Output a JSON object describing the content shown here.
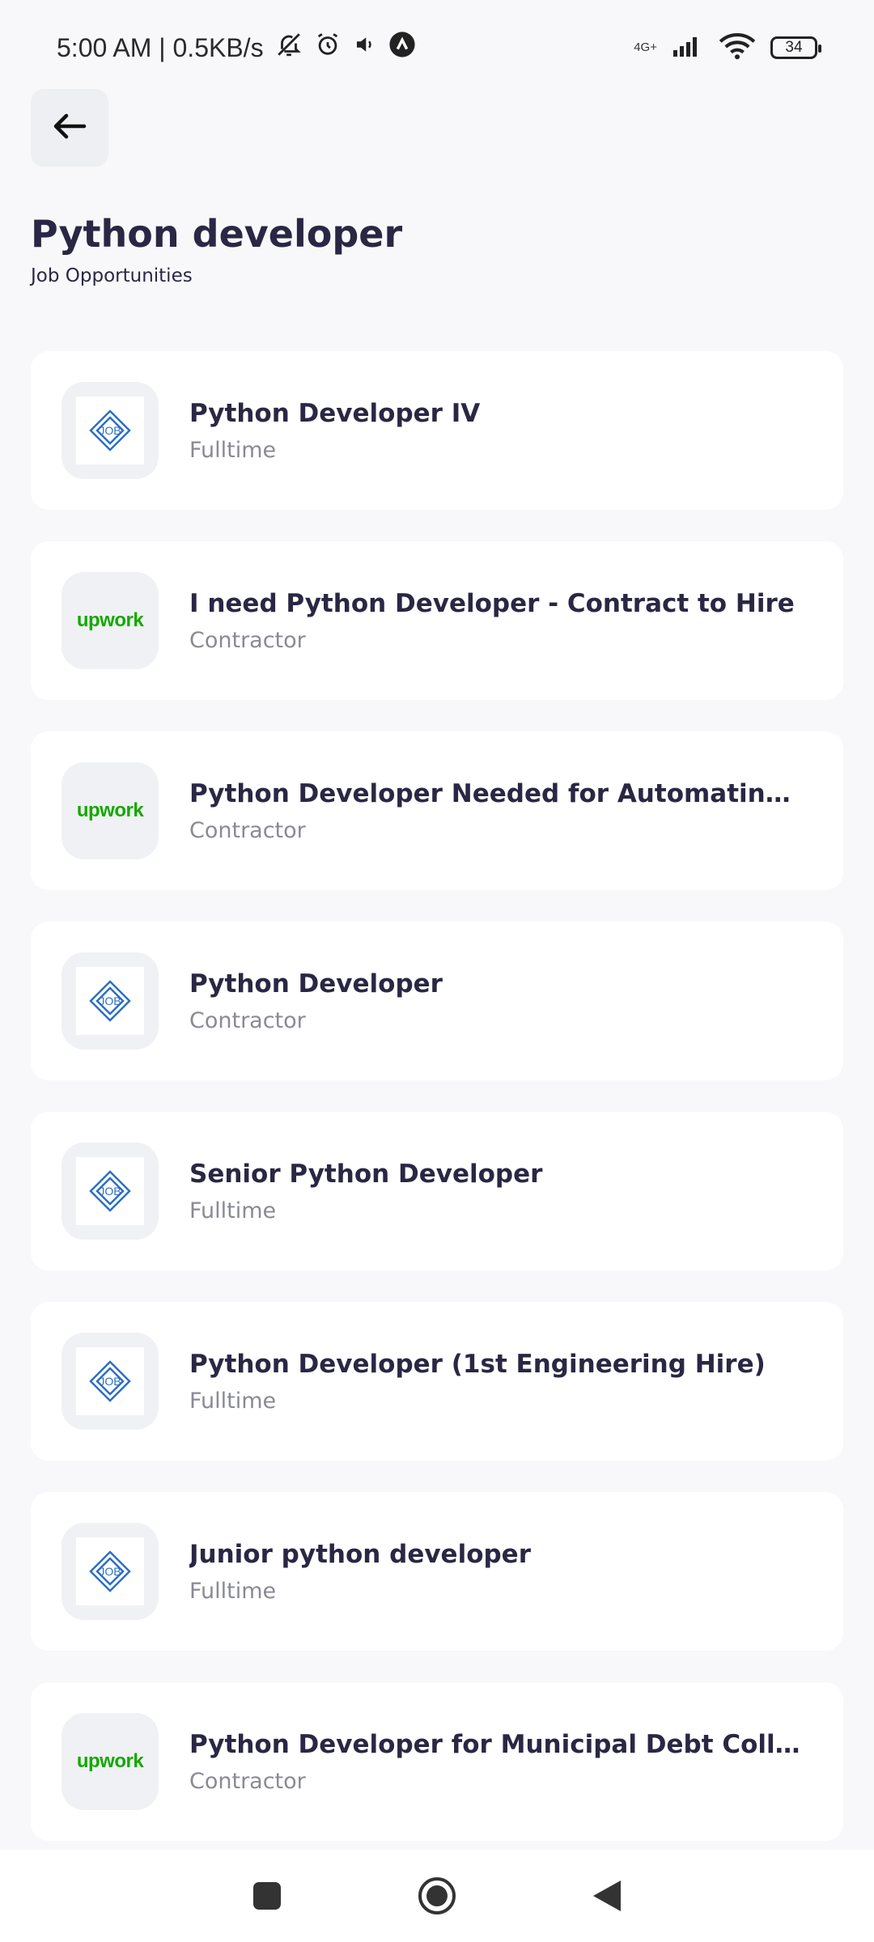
{
  "status_bar": {
    "time_speed": "5:00 AM | 0.5KB/s",
    "network": "4G+",
    "battery": "34"
  },
  "header": {
    "title": "Python developer",
    "subtitle": "Job Opportunities"
  },
  "jobs": [
    {
      "title": "Python Developer IV",
      "type": "Fulltime",
      "logo": "job-logo"
    },
    {
      "title": "I need Python Developer - Contract to Hire",
      "type": "Contractor",
      "logo": "upwork",
      "logo_text": "upwork"
    },
    {
      "title": "Python Developer Needed for Automating Job...",
      "type": "Contractor",
      "logo": "upwork",
      "logo_text": "upwork"
    },
    {
      "title": "Python Developer",
      "type": "Contractor",
      "logo": "job-logo"
    },
    {
      "title": "Senior Python Developer",
      "type": "Fulltime",
      "logo": "job-logo"
    },
    {
      "title": "Python Developer (1st Engineering Hire)",
      "type": "Fulltime",
      "logo": "job-logo"
    },
    {
      "title": "Junior python developer",
      "type": "Fulltime",
      "logo": "job-logo"
    },
    {
      "title": "Python Developer for Municipal Debt Collectio...",
      "type": "Contractor",
      "logo": "upwork",
      "logo_text": "upwork"
    }
  ],
  "colors": {
    "background": "#f8f8fa",
    "card": "#ffffff",
    "title_text": "#2a2744",
    "secondary_text": "#8a8a95",
    "upwork_green": "#14a800",
    "job_logo_blue": "#2d6fc4"
  }
}
